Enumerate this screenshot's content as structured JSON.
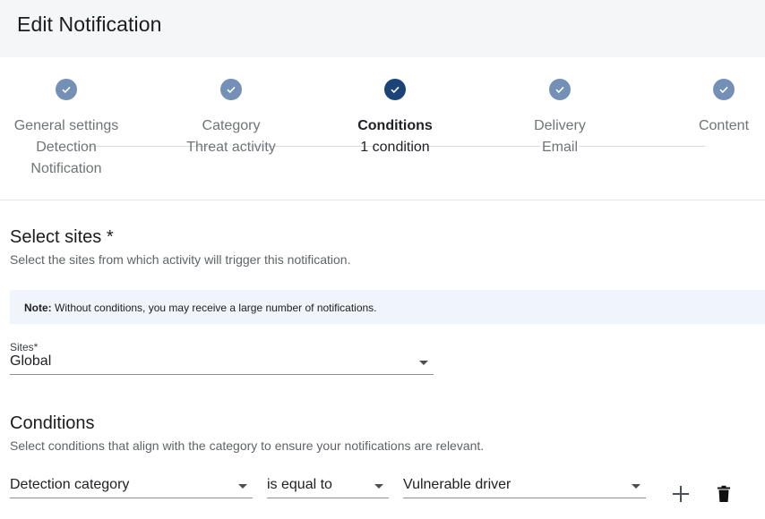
{
  "header": {
    "title": "Edit Notification"
  },
  "stepper": {
    "steps": [
      {
        "title": "General settings",
        "lines": [
          "Detection",
          "Notification"
        ],
        "active": false
      },
      {
        "title": "Category",
        "lines": [
          "Threat activity",
          ""
        ],
        "active": false
      },
      {
        "title": "Conditions",
        "lines": [
          "1 condition",
          ""
        ],
        "active": true
      },
      {
        "title": "Delivery",
        "lines": [
          "Email",
          ""
        ],
        "active": false
      },
      {
        "title": "Content",
        "lines": [
          "",
          ""
        ],
        "active": false
      }
    ]
  },
  "sites_section": {
    "title": "Select sites *",
    "description": "Select the sites from which activity will trigger this notification."
  },
  "note": {
    "label": "Note:",
    "text": " Without conditions, you may receive a large number of notifications."
  },
  "sites_field": {
    "label": "Sites*",
    "value": "Global"
  },
  "conditions_section": {
    "title": "Conditions",
    "description": "Select conditions that align with the category to ensure your notifications are relevant."
  },
  "condition_row": {
    "field": "Detection category",
    "operator": "is equal to",
    "value": "Vulnerable driver"
  },
  "icons": {
    "add": "plus-icon",
    "delete": "trash-icon",
    "step_done": "check-icon"
  },
  "colors": {
    "step_done": "#7590b6",
    "step_active": "#1b4377",
    "note_bg": "#f0f4fb"
  }
}
